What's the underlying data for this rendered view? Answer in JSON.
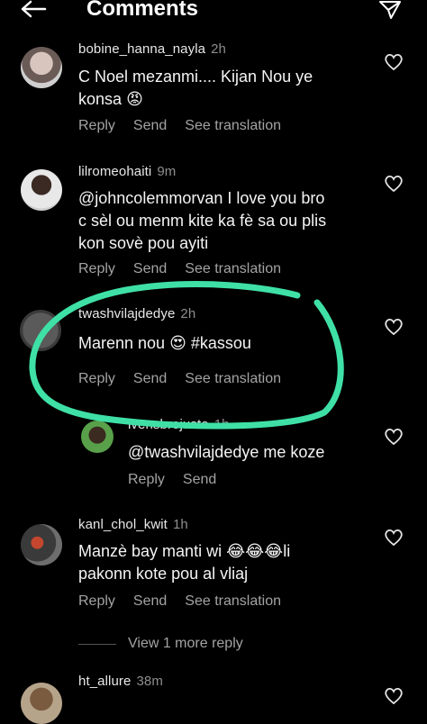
{
  "header": {
    "title": "Comments"
  },
  "comments": [
    {
      "user": "bobine_hanna_nayla",
      "time": "2h",
      "line1": "C Noel mezanmi.... Kijan Nou ye",
      "line2": "konsa",
      "emoji": "😡"
    },
    {
      "user": "lilromeohaiti",
      "time": "9m",
      "line1": "@johncolemmorvan I love you bro",
      "line2": "c sèl ou menm kite ka fè sa ou plis",
      "line3": "kon sovè pou ayiti"
    },
    {
      "user": "twashvilajdedye",
      "time": "2h",
      "line1": "Marenn nou",
      "emoji": "😍",
      "hashtag": "#kassou"
    },
    {
      "user": "ivensbrejuste",
      "time": "1h",
      "line1": "@twashvilajdedye me koze"
    },
    {
      "user": "kanl_chol_kwit",
      "time": "1h",
      "line1": "Manzè bay manti wi",
      "emoji": "😂😂😂",
      "line1b": "li",
      "line2": "pakonn kote pou al vliaj"
    },
    {
      "user": "ht_allure",
      "time": "38m"
    }
  ],
  "actions": {
    "reply": "Reply",
    "send": "Send",
    "translate": "See translation"
  },
  "view_more": "View 1 more reply",
  "colors": {
    "highlight": "#3fe0a6",
    "heart_emoji": "#e24a3a"
  }
}
